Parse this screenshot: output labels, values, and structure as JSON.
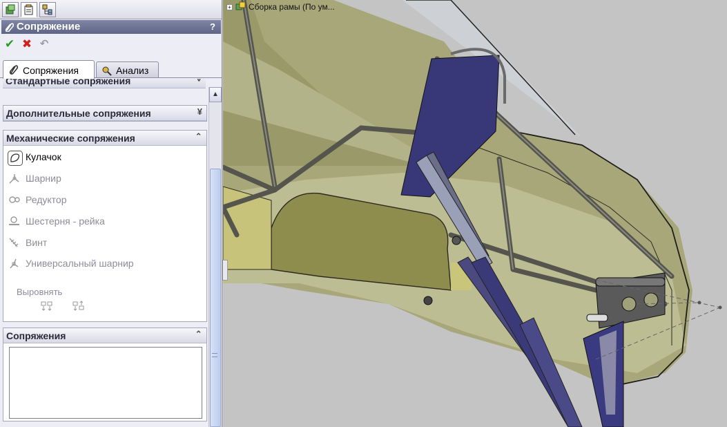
{
  "panel": {
    "title": "Сопряжение",
    "help": "?",
    "tabs": [
      {
        "label": "Сопряжения",
        "active": true
      },
      {
        "label": "Анализ",
        "active": false
      }
    ],
    "groups": {
      "standard": {
        "title": "Стандартные сопряжения",
        "chevron": "˅"
      },
      "advanced": {
        "title": "Дополнительные сопряжения",
        "chevron": "»"
      },
      "mechanical": {
        "title": "Механические сопряжения",
        "chevron": "«",
        "items": [
          {
            "label": "Кулачок",
            "enabled": true,
            "icon": "cam-icon"
          },
          {
            "label": "Шарнир",
            "enabled": false,
            "icon": "hinge-icon"
          },
          {
            "label": "Редуктор",
            "enabled": false,
            "icon": "gear-icon"
          },
          {
            "label": "Шестерня - рейка",
            "enabled": false,
            "icon": "rack-pinion-icon"
          },
          {
            "label": "Винт",
            "enabled": false,
            "icon": "screw-icon"
          },
          {
            "label": "Универсальный шарнир",
            "enabled": false,
            "icon": "universal-joint-icon"
          }
        ],
        "align_label": "Выровнять"
      },
      "mates": {
        "title": "Сопряжения",
        "chevron": "«"
      }
    }
  },
  "viewport": {
    "tree_label": "Сборка рамы  (По ум..."
  },
  "colors": {
    "panel_bg": "#ededf5",
    "title_bar": "#6a7090",
    "body_shell": "#a9a878",
    "frame_tube": "#5a5a52",
    "bracket_blue": "#3a3a7a",
    "viewport_bg": "#c4c4c4"
  }
}
